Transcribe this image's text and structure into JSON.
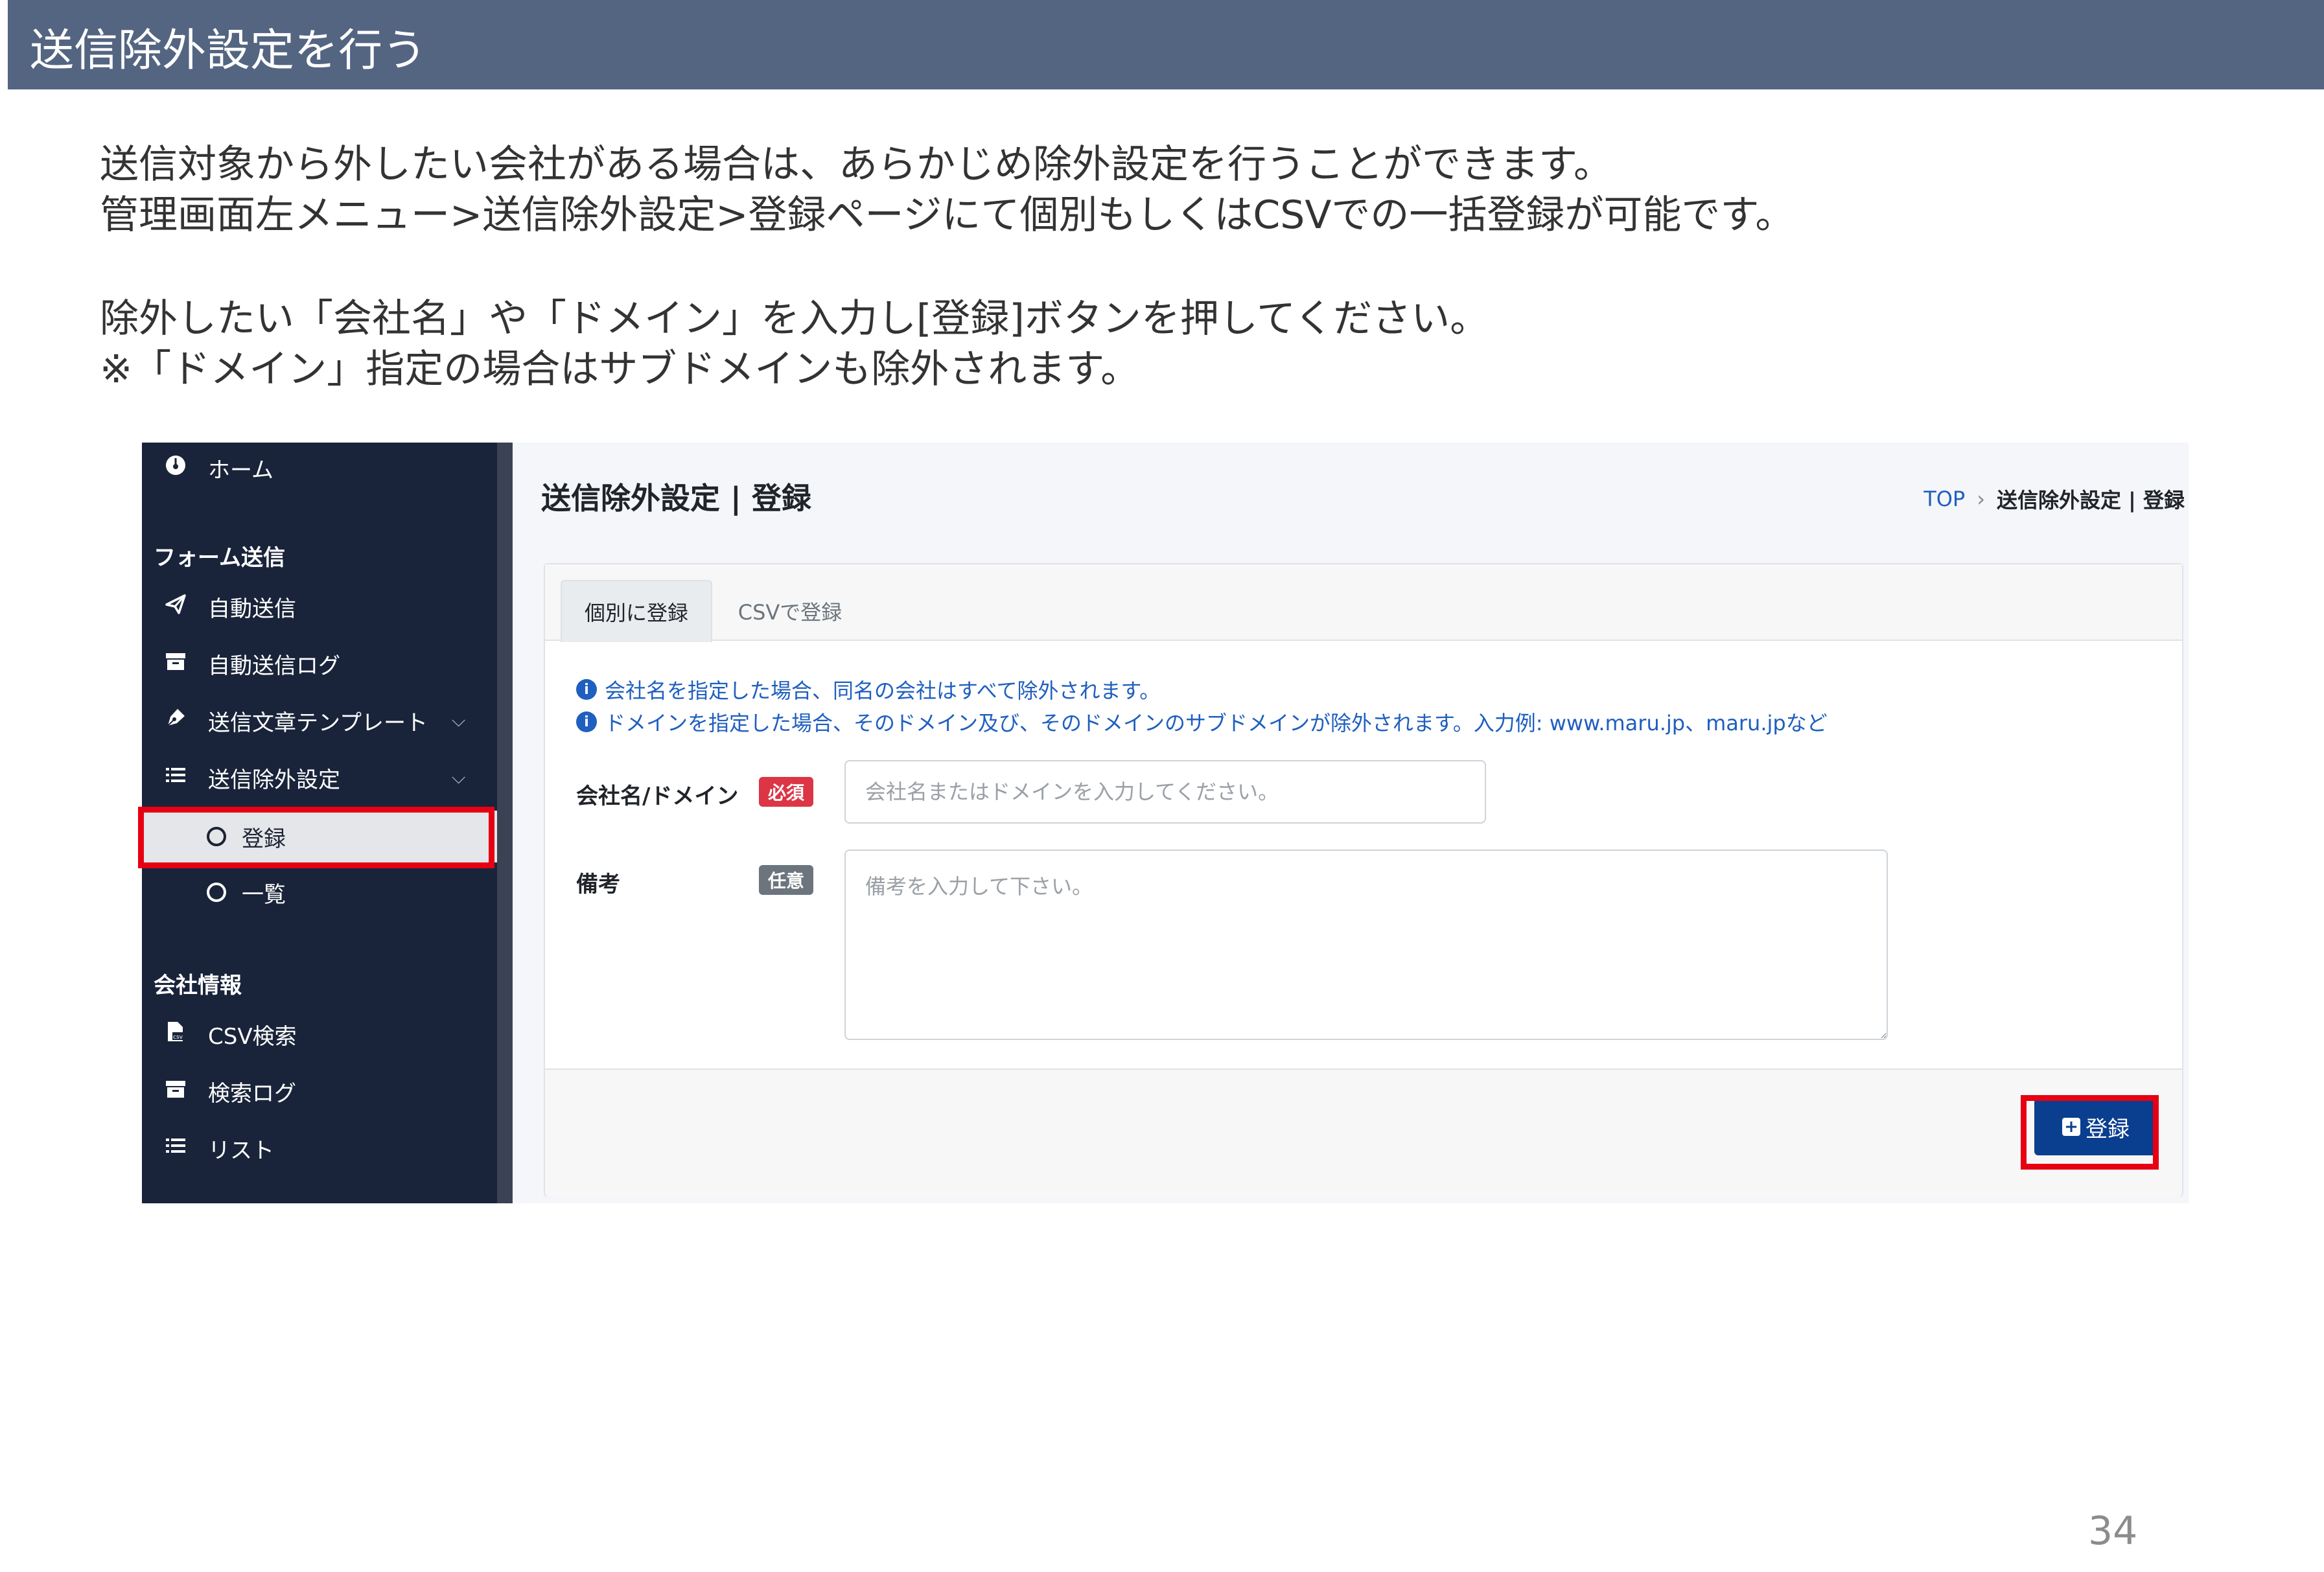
{
  "slide": {
    "title": "送信除外設定を行う",
    "desc1": "送信対象から外したい会社がある場合は、あらかじめ除外設定を行うことができます。\n管理画面左メニュー>送信除外設定>登録ページにて個別もしくはCSVでの一括登録が可能です。",
    "desc2": "除外したい「会社名」や「ドメイン」を入力し[登録]ボタンを押してください。\n※「ドメイン」指定の場合はサブドメインも除外されます。",
    "page_number": "34"
  },
  "sidebar": {
    "home": "ホーム",
    "section_form": "フォーム送信",
    "auto_send": "自動送信",
    "auto_send_log": "自動送信ログ",
    "template": "送信文章テンプレート",
    "exclusion": "送信除外設定",
    "exclusion_register": "登録",
    "exclusion_list": "一覧",
    "section_company": "会社情報",
    "csv_search": "CSV検索",
    "search_log": "検索ログ",
    "list": "リスト"
  },
  "main": {
    "page_title": "送信除外設定 | 登録",
    "breadcrumb_top": "TOP",
    "breadcrumb_sep": "›",
    "breadcrumb_current": "送信除外設定 | 登録",
    "tab_individual": "個別に登録",
    "tab_csv": "CSVで登録",
    "info1": "会社名を指定した場合、同名の会社はすべて除外されます。",
    "info2": "ドメインを指定した場合、そのドメイン及び、そのドメインのサブドメインが除外されます。入力例: www.maru.jp、maru.jpなど",
    "field_company_label": "会社名/ドメイン",
    "badge_required": "必須",
    "company_placeholder": "会社名またはドメインを入力してください。",
    "field_note_label": "備考",
    "badge_optional": "任意",
    "note_placeholder": "備考を入力して下さい。",
    "submit_label": "登録"
  },
  "icons": {
    "info": "i",
    "plus": "+"
  }
}
